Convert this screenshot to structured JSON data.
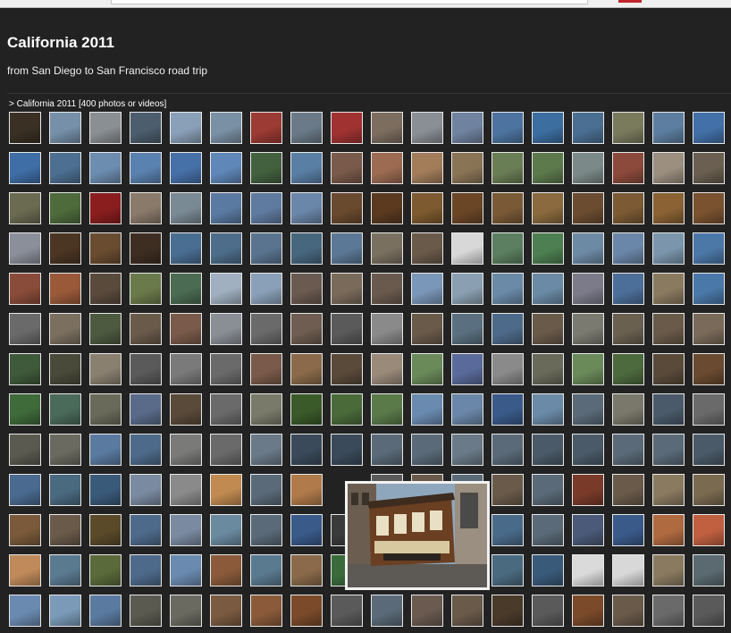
{
  "album": {
    "title": "California 2011",
    "subtitle": "from San Diego to San Francisco road trip",
    "breadcrumb_arrow": ">",
    "breadcrumb_name": "California 2011",
    "breadcrumb_count": "[400 photos or videos]"
  },
  "grid": {
    "columns": 18,
    "rows": 13,
    "preview_cell": {
      "row": 9,
      "col": 8
    }
  },
  "preview": {
    "subject": "cable-car-photo"
  },
  "colors": {
    "background": "#222222",
    "thumb_border": "#e8e8e8",
    "accent_red": "#c0272d"
  },
  "thumbnails": [
    [
      "#3a3024",
      "#7590a8",
      "#8a8f93",
      "#4c5d6d",
      "#8aa0b8",
      "#7a90a4",
      "#9c3a34",
      "#6a7a88",
      "#a03232",
      "#7c6d5f",
      "#8a8f96",
      "#6f82a0",
      "#4d74a0",
      "#3c6ea0",
      "#4a6f92",
      "#7a7b5d",
      "#5d7ea0",
      "#4370a8"
    ],
    [
      "#3f6ea6",
      "#4d6f92",
      "#6c8db0",
      "#5a82b0",
      "#4670a8",
      "#5f87b8",
      "#43613f",
      "#5a7fa5",
      "#7a5a4a",
      "#9c6b52",
      "#a37d5a",
      "#8a7456",
      "#6a7e55",
      "#5d7a4d",
      "#7b8a88",
      "#8c4a3c",
      "#9c8f80",
      "#6a5f50"
    ],
    [
      "#6b6b52",
      "#4e6b3c",
      "#8a1e1e",
      "#8a7a6a",
      "#7a8a95",
      "#5a7aa2",
      "#5f7ba0",
      "#6a86a8",
      "#6a4a2e",
      "#5b3a20",
      "#7e5a30",
      "#6b4626",
      "#7a5a36",
      "#8a6a3e",
      "#6b4c30",
      "#7b5a34",
      "#8a6234",
      "#7a5230"
    ],
    [
      "#8b8f9a",
      "#4b3523",
      "#6a4c30",
      "#3e2e22",
      "#4a6e92",
      "#4d6d8a",
      "#5a7490",
      "#47677f",
      "#5b7896",
      "#7a7060",
      "#6a5a4a",
      "#d8d8d8",
      "#5b7f60",
      "#4d7f52",
      "#6d8aa5",
      "#6a86a8",
      "#7a95ac",
      "#4c78a8"
    ],
    [
      "#8a4c3a",
      "#9a5a3a",
      "#5a4a3c",
      "#6b7a4a",
      "#4b6b52",
      "#a0b0c0",
      "#8aa0b8",
      "#6a5a50",
      "#7a6a5a",
      "#6a5a4e",
      "#7a96b8",
      "#8aa0b2",
      "#6a8aa8",
      "#6a8aa5",
      "#7b7b8a",
      "#4c6f9a",
      "#8a7a60",
      "#4a78a8"
    ],
    [
      "#6a6a6a",
      "#7b7060",
      "#4d5a40",
      "#6a5a4a",
      "#7a5a4a",
      "#8a8f96",
      "#6a6a6a",
      "#6e5d50",
      "#5a5a5a",
      "#8a8a8a",
      "#6a5a4a",
      "#5a7080",
      "#4d6a8a",
      "#6a5a4a",
      "#7a7a70",
      "#6a6050",
      "#6a5a4a",
      "#7a6a5a"
    ],
    [
      "#3f5a3a",
      "#4a4a3a",
      "#8a8070",
      "#5a5a5a",
      "#7a7a7a",
      "#6a6a6a",
      "#7a5a4a",
      "#8a6a4a",
      "#5a4a3a",
      "#9a8a7a",
      "#6a8a5a",
      "#5a6a9a",
      "#8a8a8a",
      "#6a6a5a",
      "#6a8a5a",
      "#4d6a3e",
      "#5a4a3a",
      "#6a4a30"
    ],
    [
      "#3f6a3a",
      "#4a6a5a",
      "#6a6a5a",
      "#5a6b8a",
      "#5a4a3a",
      "#6a6a6a",
      "#7a7a6a",
      "#3a5a2a",
      "#4a6a3a",
      "#5a7a4a",
      "#6a8ab0",
      "#6a86a8",
      "#3a5a8a",
      "#6a8aa8",
      "#5a6a78",
      "#7a786a",
      "#4a5a6a",
      "#6a6a6a"
    ],
    [
      "#5a5a50",
      "#6a6a60",
      "#5a7aa0",
      "#4d6a8a",
      "#7a7a78",
      "#6a6a6a",
      "#6a7a88",
      "#3a4a5a",
      "#3a4a5a",
      "#5a6a78",
      "#5a6a78",
      "#6a7a88",
      "#5a6a78",
      "#4a5a68",
      "#4a5a68",
      "#5a6a78",
      "#5a6a78",
      "#4a5a68"
    ],
    [
      "#4a6a90",
      "#4a6a80",
      "#3a5a7a",
      "#7a8aa0",
      "#8a8a8a",
      "#c08a50",
      "#5a6a78",
      "#b07a4a",
      "#4a3a2a",
      "#5a5a5a",
      "#6a5a4a",
      "#5a6a78",
      "#6a5a4a",
      "#5a6a78",
      "#7a3a2a",
      "#6a5a4a",
      "#8a7a60",
      "#7a6a50"
    ],
    [
      "#7a5a3a",
      "#6a5a4a",
      "#5a4a2a",
      "#4d6a8a",
      "#7a8aa0",
      "#6a8aa0",
      "#5a6a78",
      "#3a5a8a",
      "#3a3a3a",
      "#5a7aa0",
      "#4a6a90",
      "#4a6a8a",
      "#4a6a8a",
      "#5a6a78",
      "#4a5a78",
      "#3a5a8a",
      "#b06a40",
      "#c06040"
    ],
    [
      "#c08a5a",
      "#5a7a90",
      "#5a6a3a",
      "#4d6a8a",
      "#6a8ab0",
      "#8a5a3a",
      "#5a7a90",
      "#8a6a4a",
      "#3a6a3a",
      "#4a6a8a",
      "#7a7a78",
      "#6a6a6a",
      "#4a6a80",
      "#3a5a7a",
      "#dadada",
      "#d8d8d8",
      "#8a7a60",
      "#5a6a70"
    ],
    [
      "#6a8ab0",
      "#7a9ab8",
      "#5a7aa0",
      "#5a5a50",
      "#6a6a60",
      "#7a5a40",
      "#8a5a3a",
      "#7a4a2a",
      "#5a5a5a",
      "#5a6a78",
      "#6a5a50",
      "#6a5a4a",
      "#4a3a2a",
      "#5a5a5a",
      "#7a4a2a",
      "#6a5a4a",
      "#6a6a6a",
      "#5a5a5a"
    ]
  ]
}
